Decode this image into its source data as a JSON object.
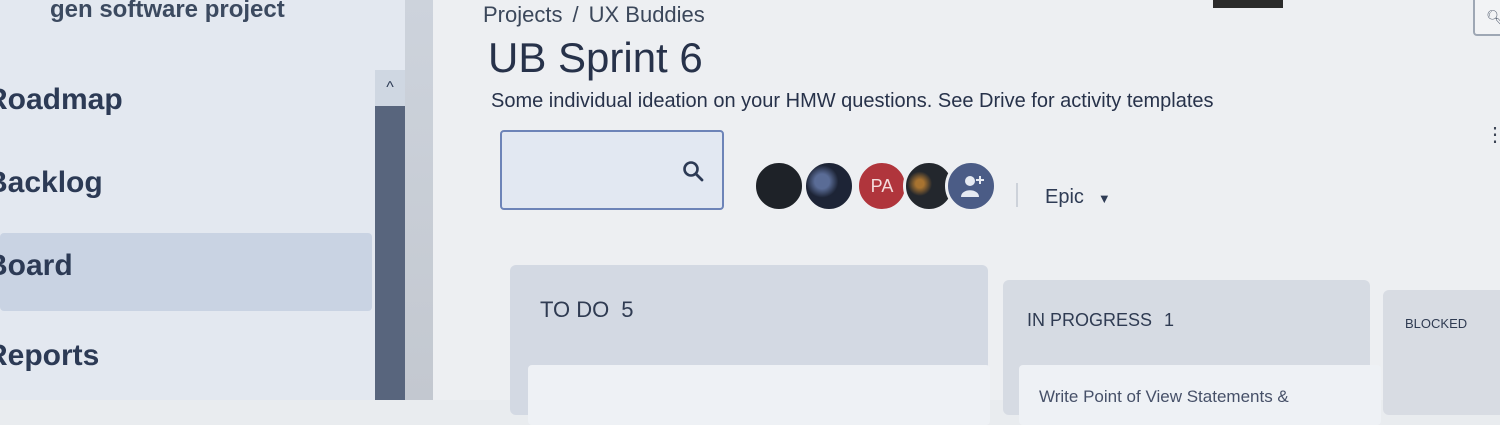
{
  "sidebar": {
    "project_name": "gen software project",
    "items": [
      {
        "label": "Roadmap"
      },
      {
        "label": "Backlog"
      },
      {
        "label": "Board",
        "active": true
      },
      {
        "label": "Reports"
      }
    ],
    "scroll_up_glyph": "^"
  },
  "header": {
    "breadcrumb": [
      "Projects",
      "UX Buddies"
    ],
    "breadcrumb_separator": "/",
    "title": "UB Sprint 6",
    "description": "Some individual ideation on your HMW questions. See Drive for activity templates"
  },
  "toolbar": {
    "search_placeholder": "",
    "search_icon": "search-icon",
    "avatars": [
      {
        "initials": ""
      },
      {
        "initials": ""
      },
      {
        "initials": "PA"
      },
      {
        "initials": ""
      }
    ],
    "add_people_icon": "add-people-icon",
    "epic_filter_label": "Epic"
  },
  "board": {
    "columns": [
      {
        "name": "TO DO",
        "count": "5"
      },
      {
        "name": "IN PROGRESS",
        "count": "1"
      },
      {
        "name": "BLOCKED",
        "count": ""
      }
    ],
    "in_progress_card_text": "Write Point of View Statements &"
  },
  "colors": {
    "sidebar_bg": "#e3e8f0",
    "active_nav_bg": "#c9d3e3",
    "main_bg": "#edeff2",
    "accent": "#6d84b8",
    "avatar_pa": "#b0353c"
  }
}
